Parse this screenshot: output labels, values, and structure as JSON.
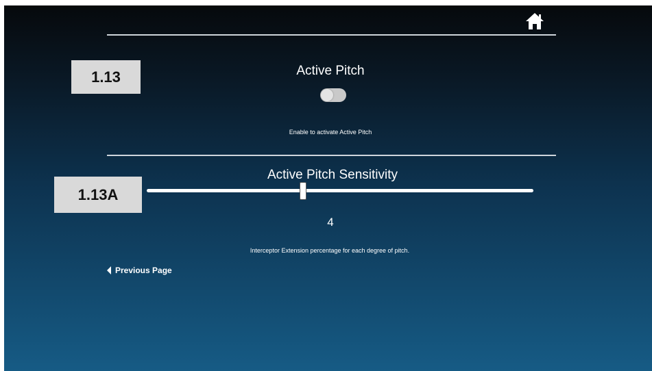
{
  "header": {
    "home_icon": "home-icon"
  },
  "section_pitch": {
    "tag": "1.13",
    "title": "Active Pitch",
    "toggle_on": false,
    "hint": "Enable to activate Active Pitch"
  },
  "section_sensitivity": {
    "tag": "1.13A",
    "title": "Active Pitch Sensitivity",
    "slider_fraction": 0.405,
    "value": "4",
    "hint": "Interceptor Extension percentage for each degree of pitch."
  },
  "footer": {
    "previous_label": "Previous Page"
  },
  "colors": {
    "accent": "#ffffff",
    "background_top": "#06090c",
    "background_bottom": "#165b85"
  }
}
